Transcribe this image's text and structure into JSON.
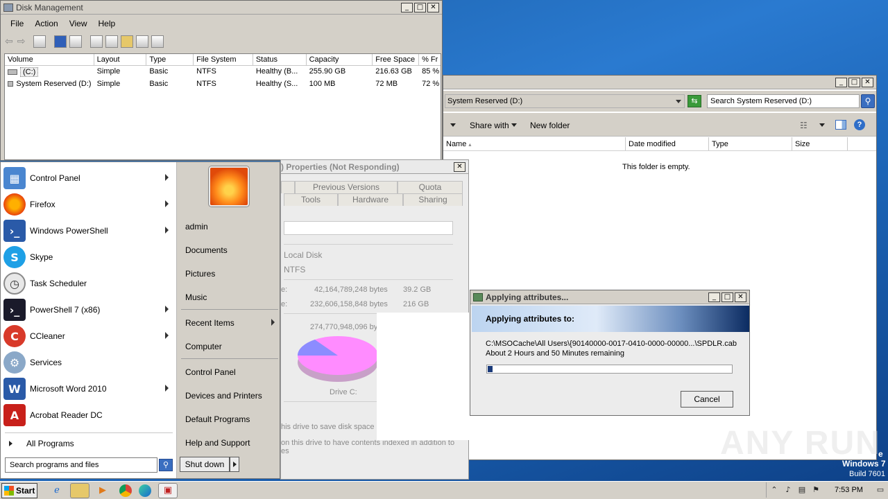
{
  "disk_mgmt": {
    "title": "Disk Management",
    "menu": [
      "File",
      "Action",
      "View",
      "Help"
    ],
    "columns": [
      "Volume",
      "Layout",
      "Type",
      "File System",
      "Status",
      "Capacity",
      "Free Space",
      "% Fr"
    ],
    "rows": [
      [
        "(C:)",
        "Simple",
        "Basic",
        "NTFS",
        "Healthy (B...",
        "255.90 GB",
        "216.63 GB",
        "85 %"
      ],
      [
        "System Reserved (D:)",
        "Simple",
        "Basic",
        "NTFS",
        "Healthy (S...",
        "100 MB",
        "72 MB",
        "72 %"
      ]
    ]
  },
  "explorer": {
    "address": "System Reserved (D:)",
    "search_placeholder": "Search System Reserved (D:)",
    "share_with": "Share with",
    "new_folder": "New folder",
    "columns": [
      "Name",
      "Date modified",
      "Type",
      "Size"
    ],
    "empty_text": "This folder is empty."
  },
  "properties": {
    "title": ") Properties (Not Responding)",
    "tabs_row1": [
      "Previous Versions",
      "Quota"
    ],
    "tabs_row2": [
      "Tools",
      "Hardware",
      "Sharing"
    ],
    "type_value": "Local Disk",
    "fs_value": "NTFS",
    "used_label": "e:",
    "used_bytes": "42,164,789,248 bytes",
    "used_gb": "39.2 GB",
    "free_label": "e:",
    "free_bytes": "232,606,158,848 bytes",
    "free_gb": "216 GB",
    "cap_bytes": "274,770,948,096 byt",
    "drive_label": "Drive C:",
    "compress_text": "his drive to save disk space",
    "index_text": "on this drive to have contents indexed in addition to",
    "index_text2": "es",
    "used_fraction": 0.153
  },
  "applying": {
    "title": "Applying attributes...",
    "heading": "Applying attributes to:",
    "path": "C:\\MSOCache\\All Users\\{90140000-0017-0410-0000-00000...\\SPDLR.cab",
    "remaining": "About 2 Hours and 50 Minutes remaining",
    "cancel": "Cancel",
    "progress": 0.02
  },
  "start_menu": {
    "pinned": [
      {
        "label": "Control Panel",
        "icon": "control-panel-icon"
      },
      {
        "label": "Firefox",
        "icon": "firefox-icon"
      },
      {
        "label": "Windows PowerShell",
        "icon": "powershell-icon"
      },
      {
        "label": "Skype",
        "icon": "skype-icon"
      },
      {
        "label": "Task Scheduler",
        "icon": "task-scheduler-icon"
      },
      {
        "label": "PowerShell 7 (x86)",
        "icon": "powershell7-icon"
      },
      {
        "label": "CCleaner",
        "icon": "ccleaner-icon"
      },
      {
        "label": "Services",
        "icon": "services-icon"
      },
      {
        "label": "Microsoft Word 2010",
        "icon": "word-icon"
      },
      {
        "label": "Acrobat Reader DC",
        "icon": "acrobat-icon"
      }
    ],
    "all_programs": "All Programs",
    "search_placeholder": "Search programs and files",
    "right": {
      "user": "admin",
      "documents": "Documents",
      "pictures": "Pictures",
      "music": "Music",
      "recent": "Recent Items",
      "computer": "Computer",
      "control_panel": "Control Panel",
      "devices": "Devices and Printers",
      "defaults": "Default Programs",
      "help": "Help and Support"
    },
    "shutdown": "Shut down"
  },
  "desktop": {
    "os_name": "Windows 7",
    "build": "Build 7601",
    "watermark": "ANY RUN",
    "trail": "e"
  },
  "taskbar": {
    "start": "Start",
    "time": "7:53 PM"
  }
}
